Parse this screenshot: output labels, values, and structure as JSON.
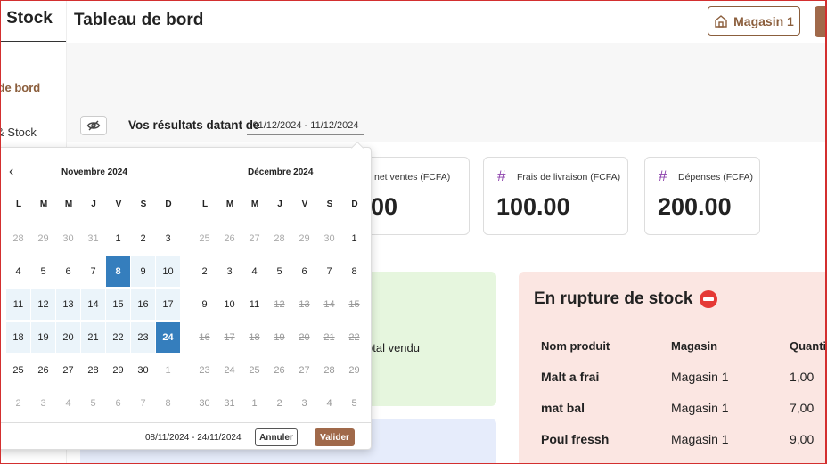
{
  "sidebar": {
    "brand": "M Stock",
    "items": [
      {
        "label": "u de bord",
        "active": true
      },
      {
        "label": "s & Stock",
        "active": false
      }
    ]
  },
  "header": {
    "title": "Tableau de bord",
    "store_button": "Magasin 1"
  },
  "filters": {
    "results_label": "Vos résultats datant de",
    "date_range": "01/12/2024 - 11/12/2024"
  },
  "stats": [
    {
      "label": "ce net ventes (FCFA)",
      "value": "00"
    },
    {
      "label": "Frais de livraison (FCFA)",
      "value": "100.00"
    },
    {
      "label": "Dépenses (FCFA)",
      "value": "200.00"
    }
  ],
  "green_panel": {
    "label": "otal vendu"
  },
  "out_of_stock": {
    "title": "En rupture de stock",
    "columns": [
      "Nom produit",
      "Magasin",
      "Quantit"
    ],
    "rows": [
      {
        "name": "Malt a frai",
        "store": "Magasin 1",
        "qty": "1,00"
      },
      {
        "name": "mat bal",
        "store": "Magasin 1",
        "qty": "7,00"
      },
      {
        "name": "Poul fressh",
        "store": "Magasin 1",
        "qty": "9,00"
      }
    ]
  },
  "datepicker": {
    "weekdays": [
      "L",
      "M",
      "M",
      "J",
      "V",
      "S",
      "D"
    ],
    "months": [
      {
        "title": "Novembre 2024",
        "weeks": [
          [
            {
              "d": "28",
              "s": "off"
            },
            {
              "d": "29",
              "s": "off"
            },
            {
              "d": "30",
              "s": "off"
            },
            {
              "d": "31",
              "s": "off"
            },
            {
              "d": "1",
              "s": ""
            },
            {
              "d": "2",
              "s": ""
            },
            {
              "d": "3",
              "s": ""
            }
          ],
          [
            {
              "d": "4",
              "s": ""
            },
            {
              "d": "5",
              "s": ""
            },
            {
              "d": "6",
              "s": ""
            },
            {
              "d": "7",
              "s": ""
            },
            {
              "d": "8",
              "s": "sel"
            },
            {
              "d": "9",
              "s": "in"
            },
            {
              "d": "10",
              "s": "in"
            }
          ],
          [
            {
              "d": "11",
              "s": "in"
            },
            {
              "d": "12",
              "s": "in"
            },
            {
              "d": "13",
              "s": "in"
            },
            {
              "d": "14",
              "s": "in"
            },
            {
              "d": "15",
              "s": "in"
            },
            {
              "d": "16",
              "s": "in"
            },
            {
              "d": "17",
              "s": "in"
            }
          ],
          [
            {
              "d": "18",
              "s": "in"
            },
            {
              "d": "19",
              "s": "in"
            },
            {
              "d": "20",
              "s": "in"
            },
            {
              "d": "21",
              "s": "in"
            },
            {
              "d": "22",
              "s": "in"
            },
            {
              "d": "23",
              "s": "in"
            },
            {
              "d": "24",
              "s": "sel"
            }
          ],
          [
            {
              "d": "25",
              "s": ""
            },
            {
              "d": "26",
              "s": ""
            },
            {
              "d": "27",
              "s": ""
            },
            {
              "d": "28",
              "s": ""
            },
            {
              "d": "29",
              "s": ""
            },
            {
              "d": "30",
              "s": ""
            },
            {
              "d": "1",
              "s": "off"
            }
          ],
          [
            {
              "d": "2",
              "s": "off"
            },
            {
              "d": "3",
              "s": "off"
            },
            {
              "d": "4",
              "s": "off"
            },
            {
              "d": "5",
              "s": "off"
            },
            {
              "d": "6",
              "s": "off"
            },
            {
              "d": "7",
              "s": "off"
            },
            {
              "d": "8",
              "s": "off"
            }
          ]
        ]
      },
      {
        "title": "Décembre 2024",
        "weeks": [
          [
            {
              "d": "25",
              "s": "off"
            },
            {
              "d": "26",
              "s": "off"
            },
            {
              "d": "27",
              "s": "off"
            },
            {
              "d": "28",
              "s": "off"
            },
            {
              "d": "29",
              "s": "off"
            },
            {
              "d": "30",
              "s": "off"
            },
            {
              "d": "1",
              "s": ""
            }
          ],
          [
            {
              "d": "2",
              "s": ""
            },
            {
              "d": "3",
              "s": ""
            },
            {
              "d": "4",
              "s": ""
            },
            {
              "d": "5",
              "s": ""
            },
            {
              "d": "6",
              "s": ""
            },
            {
              "d": "7",
              "s": ""
            },
            {
              "d": "8",
              "s": ""
            }
          ],
          [
            {
              "d": "9",
              "s": ""
            },
            {
              "d": "10",
              "s": ""
            },
            {
              "d": "11",
              "s": ""
            },
            {
              "d": "12",
              "s": "dis"
            },
            {
              "d": "13",
              "s": "dis"
            },
            {
              "d": "14",
              "s": "dis"
            },
            {
              "d": "15",
              "s": "dis"
            }
          ],
          [
            {
              "d": "16",
              "s": "dis"
            },
            {
              "d": "17",
              "s": "dis"
            },
            {
              "d": "18",
              "s": "dis"
            },
            {
              "d": "19",
              "s": "dis"
            },
            {
              "d": "20",
              "s": "dis"
            },
            {
              "d": "21",
              "s": "dis"
            },
            {
              "d": "22",
              "s": "dis"
            }
          ],
          [
            {
              "d": "23",
              "s": "dis"
            },
            {
              "d": "24",
              "s": "dis"
            },
            {
              "d": "25",
              "s": "dis"
            },
            {
              "d": "26",
              "s": "dis"
            },
            {
              "d": "27",
              "s": "dis"
            },
            {
              "d": "28",
              "s": "dis"
            },
            {
              "d": "29",
              "s": "dis"
            }
          ],
          [
            {
              "d": "30",
              "s": "dis"
            },
            {
              "d": "31",
              "s": "dis"
            },
            {
              "d": "1",
              "s": "dis"
            },
            {
              "d": "2",
              "s": "dis"
            },
            {
              "d": "3",
              "s": "dis"
            },
            {
              "d": "4",
              "s": "dis"
            },
            {
              "d": "5",
              "s": "dis"
            }
          ]
        ]
      }
    ],
    "selected_range": "08/11/2024 - 24/11/2024",
    "cancel_label": "Annuler",
    "apply_label": "Valider"
  },
  "colors": {
    "brand": "#8b5e3c",
    "selected_day": "#357ebd",
    "range_day": "#ebf4fa",
    "stat_icon": "#8e44ad"
  },
  "icons": [
    "store-icon",
    "eye-off-icon",
    "hash-icon",
    "chevron-left-icon",
    "no-entry-icon"
  ]
}
